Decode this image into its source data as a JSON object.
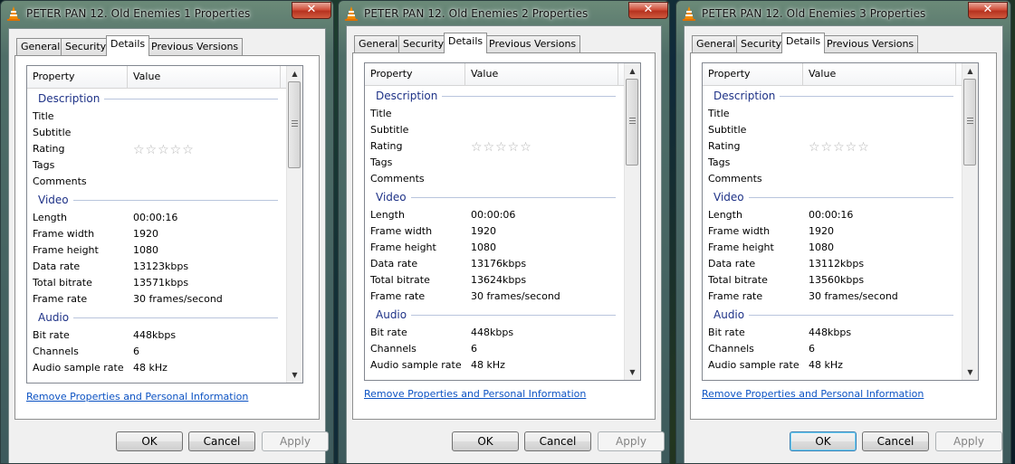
{
  "tabs": [
    {
      "label": "General"
    },
    {
      "label": "Security"
    },
    {
      "label": "Details"
    },
    {
      "label": "Previous Versions"
    }
  ],
  "columns": {
    "property": "Property",
    "value": "Value"
  },
  "groups": {
    "description": "Description",
    "video": "Video",
    "audio": "Audio"
  },
  "labels": {
    "title": "Title",
    "subtitle": "Subtitle",
    "rating": "Rating",
    "tags": "Tags",
    "comments": "Comments",
    "length": "Length",
    "frame_width": "Frame width",
    "frame_height": "Frame height",
    "data_rate": "Data rate",
    "total_bitrate": "Total bitrate",
    "frame_rate": "Frame rate",
    "bit_rate": "Bit rate",
    "channels": "Channels",
    "audio_sample_rate": "Audio sample rate"
  },
  "rating_stars": "☆☆☆☆☆",
  "link_text": "Remove Properties and Personal Information",
  "buttons": {
    "ok": "OK",
    "cancel": "Cancel",
    "apply": "Apply"
  },
  "close_glyph": "✕",
  "scroll_up_glyph": "▲",
  "scroll_down_glyph": "▼",
  "windows": [
    {
      "title": "PETER PAN 12. Old Enemies 1 Properties",
      "length": "00:00:16",
      "frame_width": "1920",
      "frame_height": "1080",
      "data_rate": "13123kbps",
      "total_bitrate": "13571kbps",
      "frame_rate": "30 frames/second",
      "bit_rate": "448kbps",
      "channels": "6",
      "audio_sample_rate": "48 kHz"
    },
    {
      "title": "PETER PAN 12. Old Enemies 2 Properties",
      "length": "00:00:06",
      "frame_width": "1920",
      "frame_height": "1080",
      "data_rate": "13176kbps",
      "total_bitrate": "13624kbps",
      "frame_rate": "30 frames/second",
      "bit_rate": "448kbps",
      "channels": "6",
      "audio_sample_rate": "48 kHz"
    },
    {
      "title": "PETER PAN 12. Old Enemies 3 Properties",
      "length": "00:00:16",
      "frame_width": "1920",
      "frame_height": "1080",
      "data_rate": "13112kbps",
      "total_bitrate": "13560kbps",
      "frame_rate": "30 frames/second",
      "bit_rate": "448kbps",
      "channels": "6",
      "audio_sample_rate": "48 kHz"
    }
  ],
  "colors": {
    "link": "#0b52c3",
    "group_header": "#1e3287",
    "close_button": "#c8432d"
  }
}
